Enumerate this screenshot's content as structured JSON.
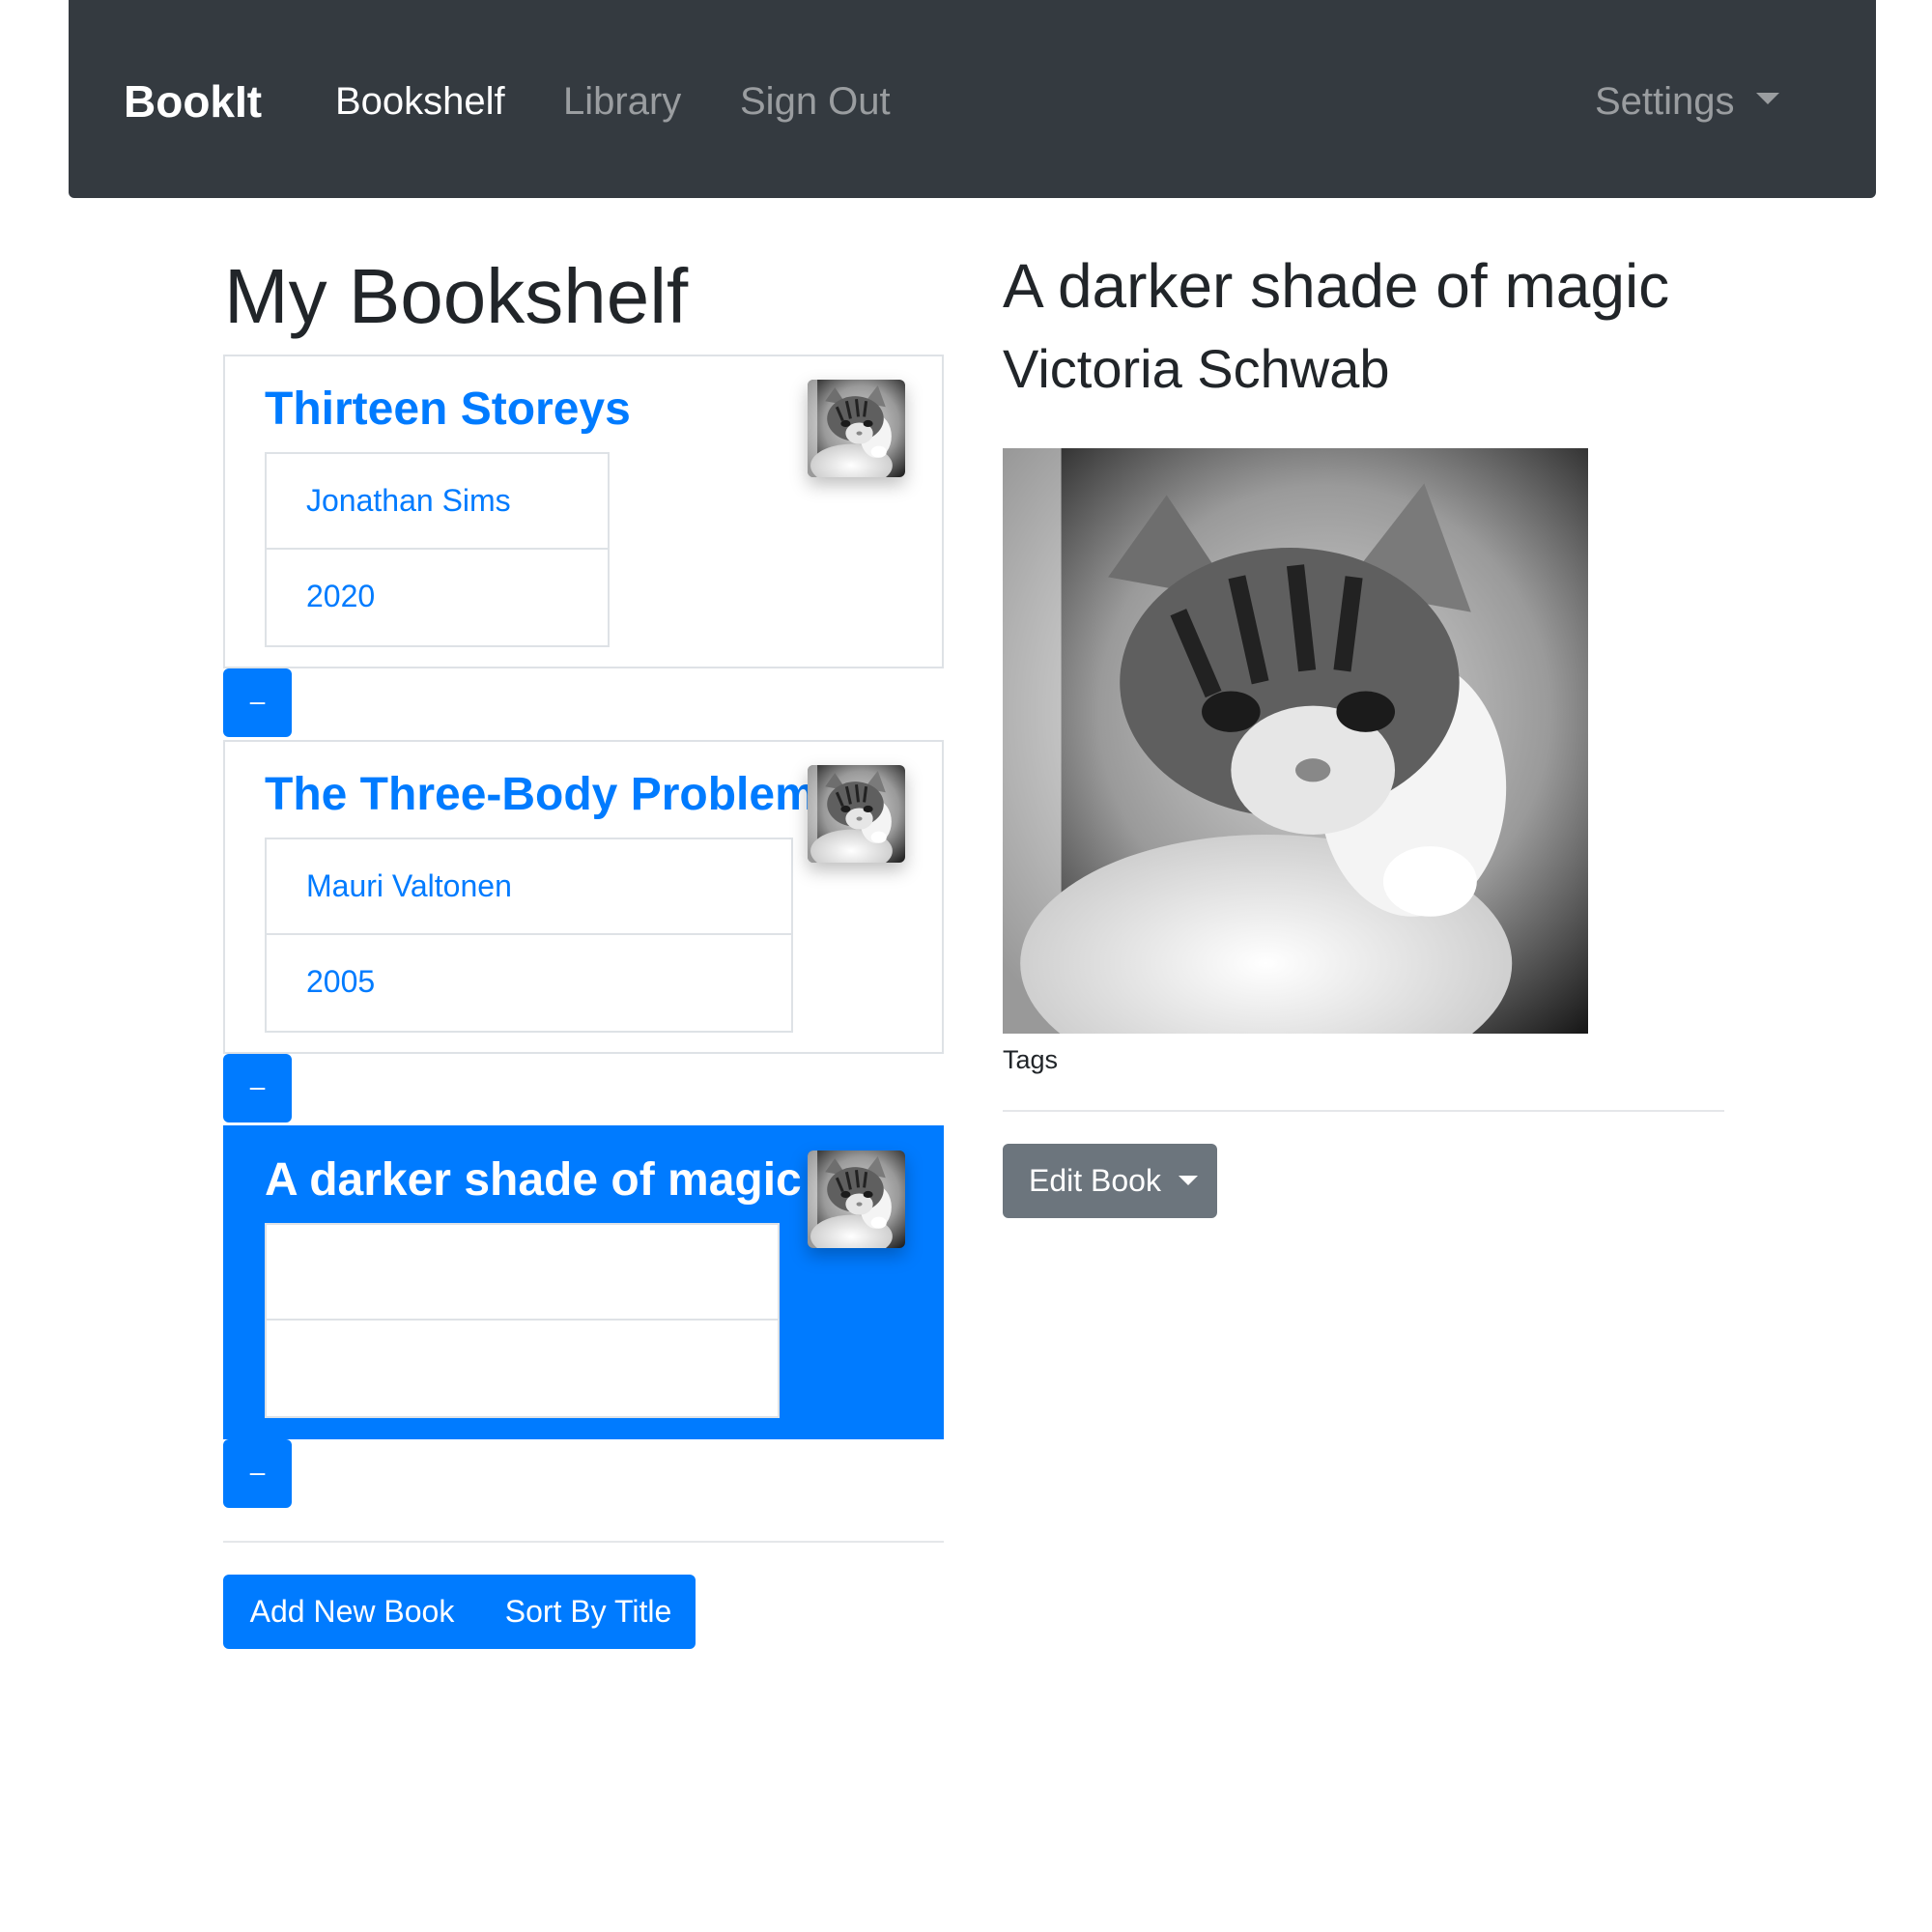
{
  "navbar": {
    "brand": "BookIt",
    "links": [
      "Bookshelf",
      "Library",
      "Sign Out"
    ],
    "active": "Bookshelf",
    "settings": "Settings"
  },
  "bookshelf": {
    "title": "My Bookshelf",
    "books": [
      {
        "title": "Thirteen Storeys",
        "author": "Jonathan Sims",
        "year": "2020",
        "thumbnail": "kitten-photo",
        "active": false
      },
      {
        "title": "The Three-Body Problem",
        "author": "Mauri Valtonen",
        "year": "2005",
        "thumbnail": "kitten-photo",
        "active": false
      },
      {
        "title": "A darker shade of magic",
        "author": "",
        "year": "",
        "thumbnail": "kitten-photo",
        "active": true
      }
    ],
    "remove_label": "–",
    "add_label": "Add New Book",
    "sort_label": "Sort By Title"
  },
  "detail": {
    "title": "A darker shade of magic",
    "author": "Victoria Schwab",
    "image": "kitten-photo",
    "tags_label": "Tags",
    "edit_label": "Edit Book"
  },
  "colors": {
    "navbar": "#343a40",
    "primary": "#007bff",
    "secondary": "#6c757d"
  }
}
